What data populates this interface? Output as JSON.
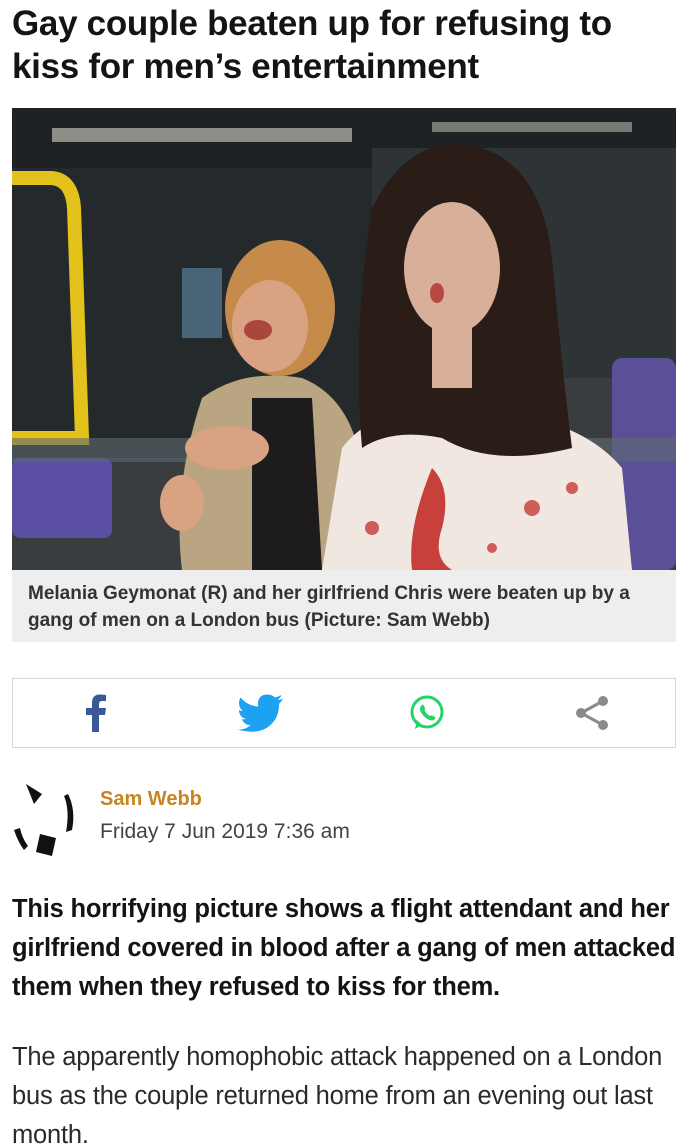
{
  "article": {
    "headline": "Gay couple beaten up for refusing to kiss for men’s entertainment",
    "photo": {
      "description_icon": "photo-image"
    },
    "caption": "Melania Geymonat (R) and her girlfriend Chris were beaten up by a gang of men on a London bus (Picture: Sam Webb)",
    "share": {
      "icons": [
        "facebook-icon",
        "twitter-icon",
        "whatsapp-icon",
        "share-icon"
      ],
      "colors": {
        "facebook": "#3b5998",
        "twitter": "#1da1f2",
        "whatsapp": "#25d366",
        "share": "#8a8a8a"
      }
    },
    "byline": {
      "author": "Sam Webb",
      "date": "Friday 7 Jun 2019 7:36 am",
      "author_color": "#c8841f"
    },
    "lead": "This horrifying picture shows a flight attendant and her girlfriend covered in blood after a gang of men attacked them when they refused to kiss for them.",
    "body": "The apparently homophobic attack happened on a London bus as the couple returned home from an evening out last month."
  }
}
